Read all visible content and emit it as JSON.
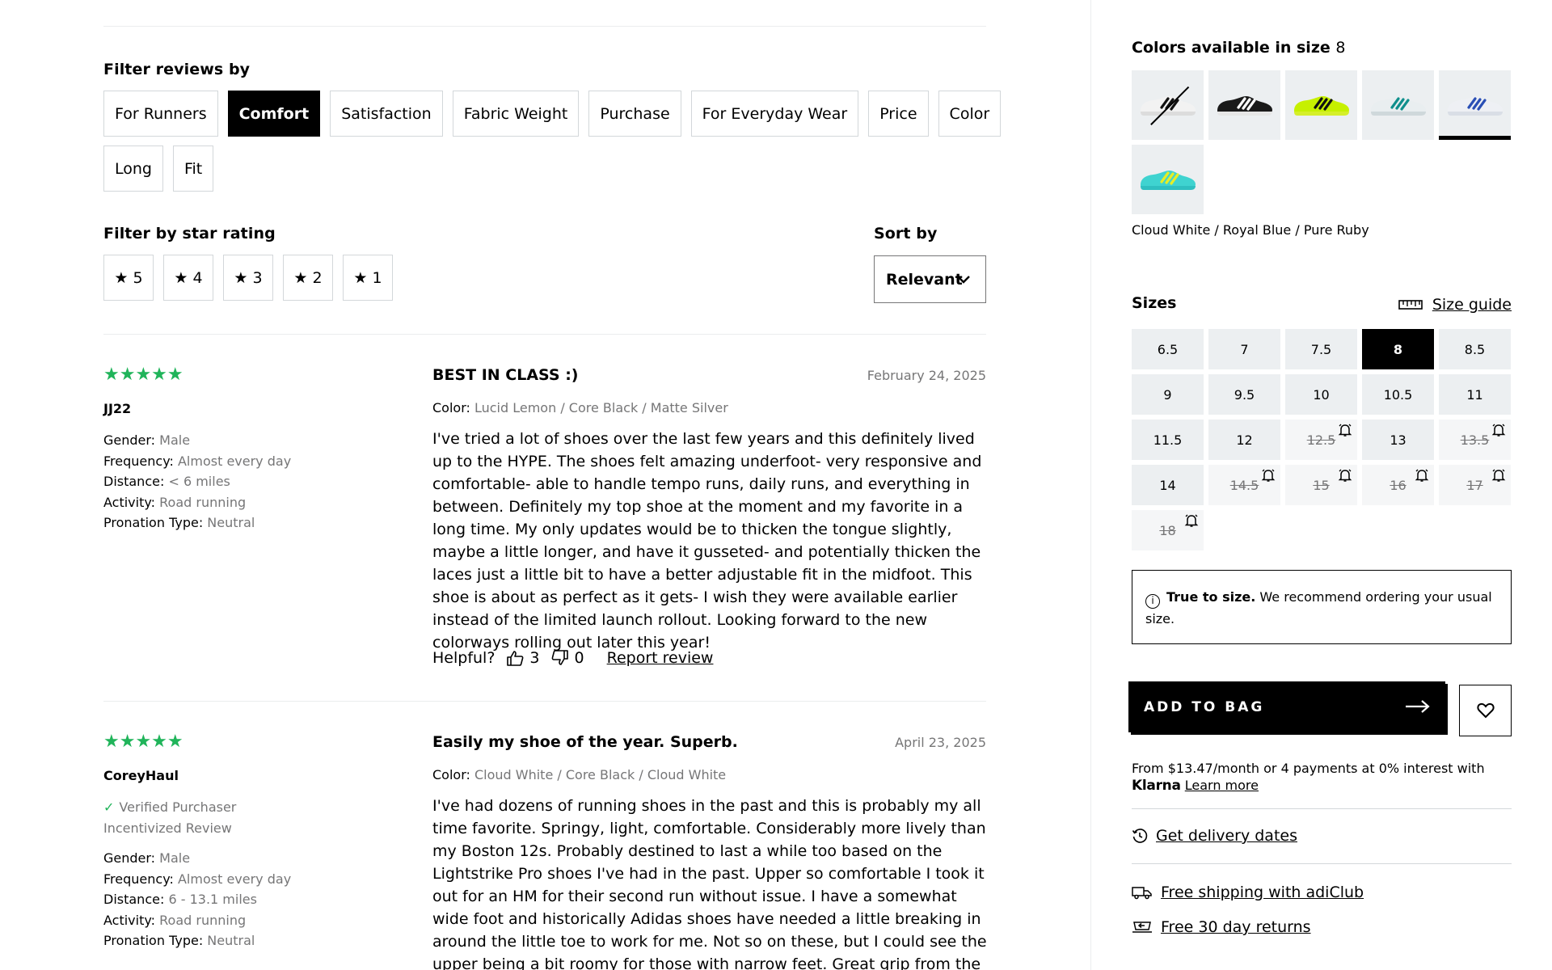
{
  "filters": {
    "reviews_label": "Filter reviews by",
    "topics": [
      {
        "label": "For Runners",
        "active": false
      },
      {
        "label": "Comfort",
        "active": true
      },
      {
        "label": "Satisfaction",
        "active": false
      },
      {
        "label": "Fabric Weight",
        "active": false
      },
      {
        "label": "Purchase",
        "active": false
      },
      {
        "label": "For Everyday Wear",
        "active": false
      },
      {
        "label": "Price",
        "active": false
      },
      {
        "label": "Color",
        "active": false
      },
      {
        "label": "Long",
        "active": false
      },
      {
        "label": "Fit",
        "active": false
      }
    ],
    "star_label": "Filter by star rating",
    "star_glyph": "★",
    "stars": [
      "5",
      "4",
      "3",
      "2",
      "1"
    ],
    "sort_label": "Sort by",
    "sort_value": "Relevant"
  },
  "reviews": [
    {
      "rating_glyphs": "★★★★★",
      "reviewer": "JJ22",
      "verified": null,
      "incentivized": null,
      "attributes": [
        {
          "k": "Gender:",
          "v": "Male"
        },
        {
          "k": "Frequency:",
          "v": "Almost every day"
        },
        {
          "k": "Distance:",
          "v": "< 6 miles"
        },
        {
          "k": "Activity:",
          "v": "Road running"
        },
        {
          "k": "Pronation Type:",
          "v": "Neutral"
        }
      ],
      "title": "BEST IN CLASS :)",
      "date": "February 24, 2025",
      "color_key": "Color:",
      "color_value": "Lucid Lemon / Core Black / Matte Silver",
      "body": "I've tried a lot of shoes over the last few years and this definitely lived up to the HYPE. The shoes felt amazing underfoot- very responsive and comfortable- able to handle tempo runs, daily runs, and everything in between. Definitely my top shoe at the moment and my favorite in a long time. My only updates would be to thicken the tongue slightly, maybe a little longer, and have it gusseted- and potentially thicken the laces just a little bit to have a better adjustable fit in the midfoot. This shoe is about as perfect as it gets- I wish they were available earlier instead of the limited launch rollout. Looking forward to the new colorways rolling out later this year!",
      "helpful_label": "Helpful?",
      "helpful_yes": "3",
      "helpful_no": "0",
      "report_label": "Report review"
    },
    {
      "rating_glyphs": "★★★★★",
      "reviewer": "CoreyHaul",
      "verified": "Verified Purchaser",
      "incentivized": "Incentivized Review",
      "attributes": [
        {
          "k": "Gender:",
          "v": "Male"
        },
        {
          "k": "Frequency:",
          "v": "Almost every day"
        },
        {
          "k": "Distance:",
          "v": "6 - 13.1 miles"
        },
        {
          "k": "Activity:",
          "v": "Road running"
        },
        {
          "k": "Pronation Type:",
          "v": "Neutral"
        }
      ],
      "title": "Easily my shoe of the year. Superb.",
      "date": "April 23, 2025",
      "color_key": "Color:",
      "color_value": "Cloud White / Core Black / Cloud White",
      "body": "I've had dozens of running shoes in the past and this is probably my all time favorite. Springy, light, comfortable. Considerably more lively than my Boston 12s. Probably destined to last a while too based on the Lightstrike Pro shoes I've had in the past. Upper so comfortable I took it out for an HM for their second run without issue. I have a somewhat wide foot and historically Adidas shoes have needed a little breaking in around the little toe to work for me. Not so on these, but I could see the upper being a bit roomy for those with narrow feet. Great grip from the outsole, as expected."
    }
  ],
  "product": {
    "colors_title": "Colors available in size",
    "colors_size": "8",
    "swatches": [
      {
        "name": "shoe-white-black",
        "upper": "#f2f2f2",
        "stripe": "#111111",
        "sole": "#dcdcdc",
        "oos": true,
        "selected": false
      },
      {
        "name": "shoe-black-white",
        "upper": "#1a1a1a",
        "stripe": "#ffffff",
        "sole": "#e6e6e6",
        "oos": false,
        "selected": false
      },
      {
        "name": "shoe-lemon-black",
        "upper": "#c6f000",
        "stripe": "#111111",
        "sole": "#d5ef2a",
        "oos": false,
        "selected": false
      },
      {
        "name": "shoe-teal-silver",
        "upper": "#e9eef0",
        "stripe": "#0f8f8c",
        "sole": "#cfd8db",
        "oos": false,
        "selected": false
      },
      {
        "name": "shoe-white-royal",
        "upper": "#eef0f4",
        "stripe": "#2a4fb5",
        "sole": "#d9dee6",
        "oos": false,
        "selected": true
      },
      {
        "name": "shoe-aqua-yellow",
        "upper": "#3fd3d0",
        "stripe": "#e6ee26",
        "sole": "#2fbfc0",
        "oos": false,
        "selected": false
      }
    ],
    "selected_color_name": "Cloud White / Royal Blue / Pure Ruby",
    "sizes_title": "Sizes",
    "size_guide_label": "Size guide",
    "sizes": [
      {
        "label": "6.5",
        "state": "available"
      },
      {
        "label": "7",
        "state": "available"
      },
      {
        "label": "7.5",
        "state": "available"
      },
      {
        "label": "8",
        "state": "selected"
      },
      {
        "label": "8.5",
        "state": "available"
      },
      {
        "label": "9",
        "state": "available"
      },
      {
        "label": "9.5",
        "state": "available"
      },
      {
        "label": "10",
        "state": "available"
      },
      {
        "label": "10.5",
        "state": "available"
      },
      {
        "label": "11",
        "state": "available"
      },
      {
        "label": "11.5",
        "state": "available"
      },
      {
        "label": "12",
        "state": "available"
      },
      {
        "label": "12.5",
        "state": "oos"
      },
      {
        "label": "13",
        "state": "available"
      },
      {
        "label": "13.5",
        "state": "oos"
      },
      {
        "label": "14",
        "state": "available"
      },
      {
        "label": "14.5",
        "state": "oos"
      },
      {
        "label": "15",
        "state": "oos"
      },
      {
        "label": "16",
        "state": "oos"
      },
      {
        "label": "17",
        "state": "oos"
      },
      {
        "label": "18",
        "state": "oos"
      }
    ],
    "fit_bold": "True to size.",
    "fit_rest": " We recommend ordering your usual size.",
    "add_to_bag": "ADD TO BAG",
    "klarna_text": "From $13.47/month or 4 payments at 0% interest with",
    "klarna_brand": "Klarna",
    "klarna_link": "Learn more",
    "delivery_link": "Get delivery dates",
    "shipping_link": "Free shipping with adiClub",
    "returns_link": "Free 30 day returns",
    "colors": {
      "accent_star": "#20b45a",
      "chip_border": "#d3d7da",
      "muted": "#767677",
      "swatch_bg": "#eceff1"
    }
  }
}
